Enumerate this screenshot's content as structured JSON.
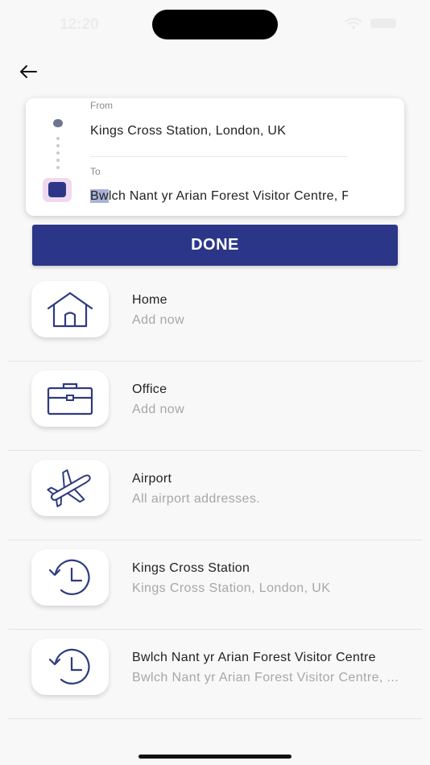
{
  "status_bar": {
    "time": "12:20"
  },
  "route": {
    "from_label": "From",
    "from_value": "Kings Cross Station, London, UK",
    "to_label": "To",
    "to_value_selected": "Bw",
    "to_value_rest": "lch Nant yr Arian Forest Visitor Centre, F"
  },
  "done_label": "DONE",
  "places": [
    {
      "title": "Home",
      "subtitle": "Add now",
      "icon": "house-icon"
    },
    {
      "title": "Office",
      "subtitle": "Add now",
      "icon": "briefcase-icon"
    },
    {
      "title": "Airport",
      "subtitle": "All airport addresses.",
      "icon": "airplane-icon"
    },
    {
      "title": "Kings Cross Station",
      "subtitle": "Kings Cross Station, London, UK",
      "icon": "history-clock-icon"
    },
    {
      "title": "Bwlch Nant yr Arian Forest Visitor Centre",
      "subtitle": "Bwlch Nant yr Arian Forest Visitor Centre, ...",
      "icon": "history-clock-icon"
    }
  ],
  "colors": {
    "accent": "#2c3688",
    "icon_stroke": "#2f3a80",
    "subtitle": "#a7a7a7"
  }
}
